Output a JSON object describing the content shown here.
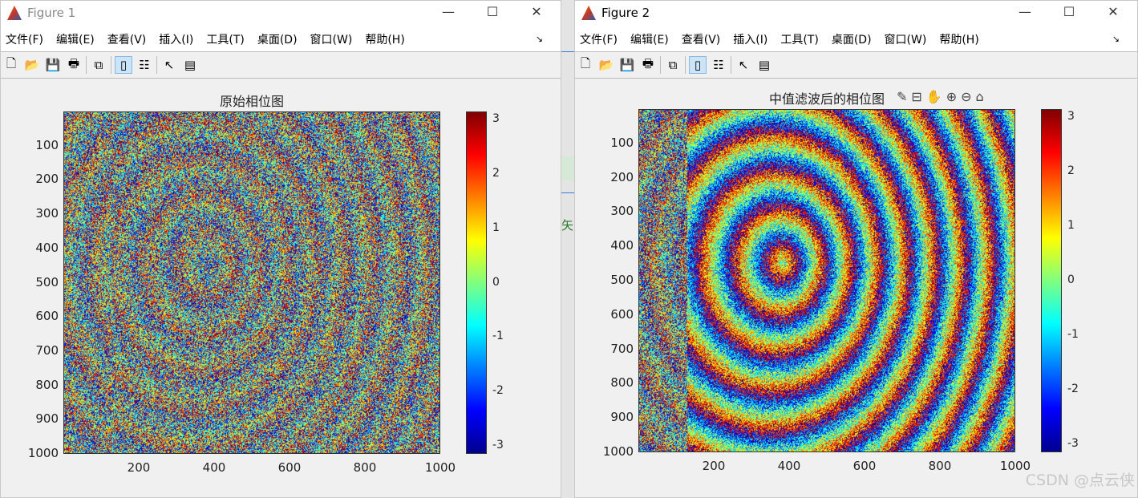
{
  "menu": [
    "文件(F)",
    "编辑(E)",
    "查看(V)",
    "插入(I)",
    "工具(T)",
    "桌面(D)",
    "窗口(W)",
    "帮助(H)"
  ],
  "figures": [
    {
      "title": "Figure 1",
      "axes_title": "原始相位图"
    },
    {
      "title": "Figure 2",
      "axes_title": "中值滤波后的相位图"
    }
  ],
  "yticks": [
    "100",
    "200",
    "300",
    "400",
    "500",
    "600",
    "700",
    "800",
    "900",
    "1000"
  ],
  "xticks": [
    "200",
    "400",
    "600",
    "800",
    "1000"
  ],
  "cticks": [
    "3",
    "2",
    "1",
    "0",
    "-1",
    "-2",
    "-3"
  ],
  "axes_toolbar": [
    "brush-icon",
    "datatip-icon",
    "pan-icon",
    "zoom-in-icon",
    "zoom-out-icon",
    "home-icon"
  ],
  "watermark": "CSDN @点云侠",
  "between_char": "矢"
}
